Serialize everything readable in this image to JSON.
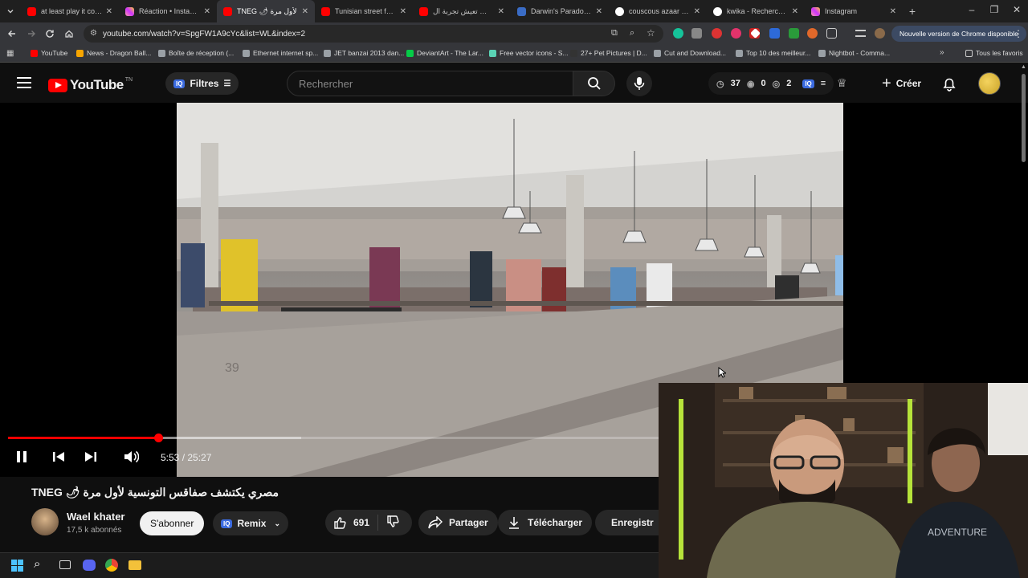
{
  "browser": {
    "tabs": [
      {
        "title": "at least play it cool -",
        "icon": "youtube-icon",
        "active": false
      },
      {
        "title": "Réaction • Instagram",
        "icon": "instagram-icon",
        "active": false
      },
      {
        "title": "TNEG 🌶 لأول مرة",
        "icon": "youtube-icon",
        "active": true
      },
      {
        "title": "Tunisian street food",
        "icon": "youtube-icon",
        "active": false
      },
      {
        "title": "كيفاش تعيش تجربة ال",
        "icon": "youtube-icon",
        "active": false
      },
      {
        "title": "Darwin's Paradox! su",
        "icon": "darwin-icon",
        "active": false
      },
      {
        "title": "couscous azaar allou",
        "icon": "google-icon",
        "active": false
      },
      {
        "title": "kwika - Recherche G",
        "icon": "google-icon",
        "active": false
      },
      {
        "title": "Instagram",
        "icon": "instagram-icon",
        "active": false
      }
    ],
    "url": "youtube.com/watch?v=SpgFW1A9cYc&list=WL&index=2",
    "update_label": "Nouvelle version de Chrome disponible",
    "bookmarks": [
      "YouTube",
      "News - Dragon Ball...",
      "Boîte de réception (...",
      "Ethernet internet sp...",
      "JET banzai 2013 dan...",
      "DeviantArt - The Lar...",
      "Free vector icons - S...",
      "27+ Pet Pictures | D...",
      "Cut and Download...",
      "Top 10 des meilleur...",
      "Nightbot - Comma..."
    ],
    "all_bookmarks": "Tous les favoris"
  },
  "youtube": {
    "logo_text": "YouTube",
    "logo_country": "TN",
    "filters_label": "Filtres",
    "iq_badge": "IQ",
    "search_placeholder": "Rechercher",
    "stats": {
      "time": "37",
      "views": "0",
      "hidden": "2"
    },
    "create_label": "Créer"
  },
  "player": {
    "time_current": "5:53",
    "time_total": "25:27",
    "time_display": "5:53 / 25:27",
    "progress_fraction": 0.231,
    "stall_number": "39"
  },
  "video": {
    "title": "مصري يكتشف صفاقس التونسية لأول مرة 🌶 TNEG",
    "channel_name": "Wael khater",
    "subscribers": "17,5 k abonnés",
    "subscribe_label": "S'abonner",
    "remix_label": "Remix",
    "likes": "691",
    "share_label": "Partager",
    "download_label": "Télécharger",
    "save_label": "Enregistr"
  },
  "colors": {
    "accent": "#ff0000",
    "background": "#0f0f0f",
    "chip": "#272727"
  }
}
